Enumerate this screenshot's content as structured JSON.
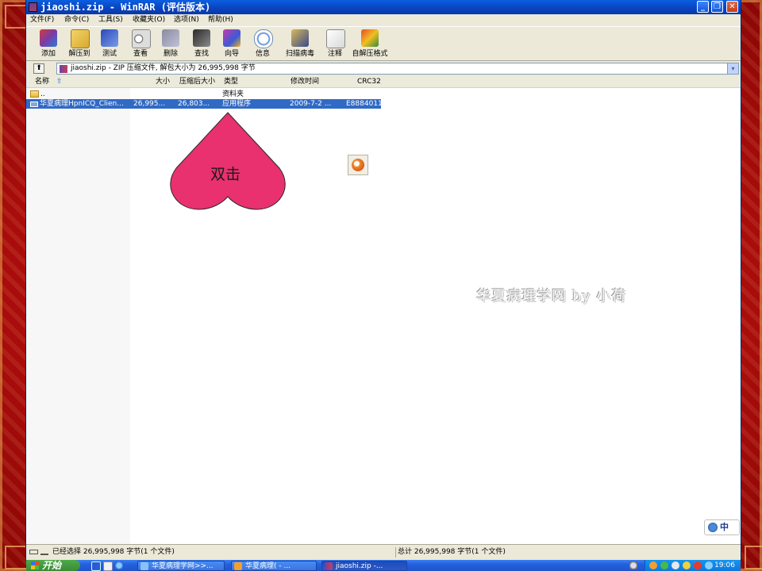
{
  "window": {
    "title": "jiaoshi.zip - WinRAR (评估版本)",
    "minimize_glyph": "_",
    "restore_glyph": "❐",
    "close_glyph": "✕"
  },
  "menu": [
    "文件(F)",
    "命令(C)",
    "工具(S)",
    "收藏夹(O)",
    "选项(N)",
    "帮助(H)"
  ],
  "toolbar": [
    {
      "label": "添加",
      "icon": "add-archive-icon"
    },
    {
      "label": "解压到",
      "icon": "extract-to-icon"
    },
    {
      "label": "测试",
      "icon": "test-icon"
    },
    {
      "label": "查看",
      "icon": "view-icon"
    },
    {
      "label": "删除",
      "icon": "delete-icon"
    },
    {
      "label": "查找",
      "icon": "find-icon"
    },
    {
      "label": "向导",
      "icon": "wizard-icon"
    },
    {
      "label": "信息",
      "icon": "info-icon"
    },
    {
      "label": "扫描病毒",
      "icon": "virus-scan-icon"
    },
    {
      "label": "注释",
      "icon": "comment-icon"
    },
    {
      "label": "自解压格式",
      "icon": "sfx-icon"
    }
  ],
  "address": {
    "up_glyph": "⬆",
    "text": "jiaoshi.zip - ZIP 压缩文件, 解包大小为 26,995,998 字节",
    "dropdown_glyph": "▾"
  },
  "columns": {
    "name": "名称",
    "sort_glyph": "⇧",
    "size": "大小",
    "packed": "压缩后大小",
    "type": "类型",
    "modified": "修改时间",
    "crc": "CRC32"
  },
  "files": [
    {
      "name": "..",
      "size": "",
      "packed": "",
      "type": "资料夹",
      "modified": "",
      "crc": "",
      "selected": false
    },
    {
      "name": "华夏病理HpnICQ_Clien...",
      "size": "26,995...",
      "packed": "26,803...",
      "type": "应用程序",
      "modified": "2009-7-2 ...",
      "crc": "E8884011",
      "selected": true
    }
  ],
  "annotation": {
    "heart_text": "双击",
    "heart_color": "#e8316e",
    "watermark": "华夏病理学网 by 小荷"
  },
  "status": {
    "left": "已经选择 26,995,998 字节(1 个文件)",
    "right": "总计 26,995,998 字节(1 个文件)"
  },
  "ime": {
    "label": "中"
  },
  "taskbar": {
    "start": "开始",
    "tasks": [
      {
        "label": "华夏病理学网>>...",
        "active": false
      },
      {
        "label": "华夏病理( - ...",
        "active": false
      },
      {
        "label": "jiaoshi.zip -...",
        "active": true
      }
    ],
    "clock": "19:06"
  },
  "colors": {
    "titlebar": "#0a46c4",
    "selection": "#316ac5",
    "frame": "#b01010"
  }
}
